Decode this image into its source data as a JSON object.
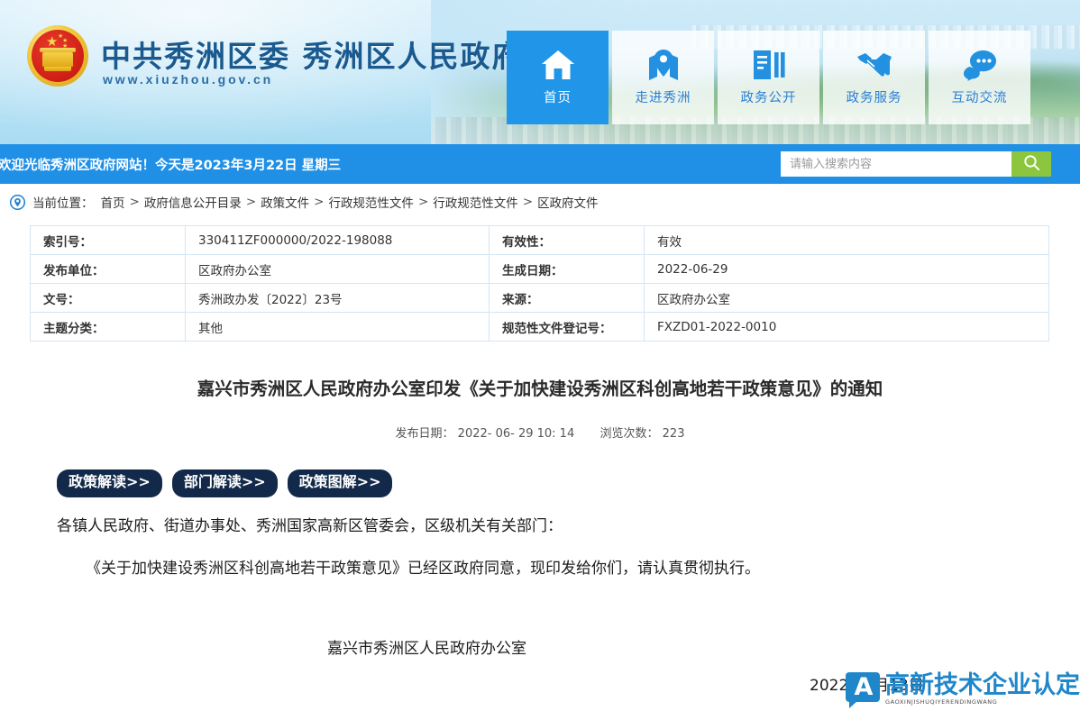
{
  "header": {
    "site_title": "中共秀洲区委 秀洲区人民政府",
    "site_url": "www.xiuzhou.gov.cn",
    "emblem_name": "national-emblem"
  },
  "nav": {
    "items": [
      {
        "label": "首页",
        "icon": "home-icon",
        "active": true
      },
      {
        "label": "走进秀洲",
        "icon": "map-pin-icon",
        "active": false
      },
      {
        "label": "政务公开",
        "icon": "document-icon",
        "active": false
      },
      {
        "label": "政务服务",
        "icon": "handshake-icon",
        "active": false
      },
      {
        "label": "互动交流",
        "icon": "chat-icon",
        "active": false
      }
    ]
  },
  "welcome": {
    "text": "欢迎光临秀洲区政府网站！今天是2023年3月22日 星期三"
  },
  "search": {
    "placeholder": "请输入搜索内容",
    "value": "",
    "button_icon": "search-icon",
    "button_color": "#8cc63e"
  },
  "breadcrumb": {
    "icon": "location-pin-icon",
    "label": "当前位置：",
    "separator": ">",
    "items": [
      "首页",
      "政府信息公开目录",
      "政策文件",
      "行政规范性文件",
      "行政规范性文件",
      "区政府文件"
    ]
  },
  "meta_table": {
    "rows": [
      {
        "k1": "索引号：",
        "v1": "330411ZF000000/2022-198088",
        "k2": "有效性：",
        "v2": "有效"
      },
      {
        "k1": "发布单位：",
        "v1": "区政府办公室",
        "k2": "生成日期：",
        "v2": "2022-06-29"
      },
      {
        "k1": "文号：",
        "v1": "秀洲政办发〔2022〕23号",
        "k2": "来源：",
        "v2": "区政府办公室"
      },
      {
        "k1": "主题分类：",
        "v1": "其他",
        "k2": "规范性文件登记号：",
        "v2": "FXZD01-2022-0010"
      }
    ]
  },
  "article": {
    "title": "嘉兴市秀洲区人民政府办公室印发《关于加快建设秀洲区科创高地若干政策意见》的通知",
    "publish_label": "发布日期：",
    "publish_date": "2022- 06- 29 10: 14",
    "views_label": "浏览次数：",
    "views": "223",
    "read_buttons": [
      {
        "label": "政策解读>>"
      },
      {
        "label": "部门解读>>"
      },
      {
        "label": "政策图解>>"
      }
    ],
    "paragraph_1": "各镇人民政府、街道办事处、秀洲国家高新区管委会，区级机关有关部门：",
    "paragraph_2": "《关于加快建设秀洲区科创高地若干政策意见》已经区政府同意，现印发给你们，请认真贯彻执行。",
    "signature": "嘉兴市秀洲区人民政府办公室",
    "sign_date": "2022年6月13日"
  },
  "watermark": {
    "letter": "A",
    "cn": "高新技术企业认定网",
    "en": "GAOXINJISHUQIYERENDINGWANG",
    "color": "#1f87c9"
  }
}
